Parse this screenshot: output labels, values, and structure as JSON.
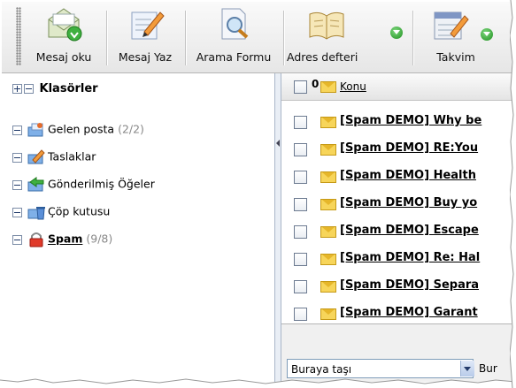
{
  "toolbar": {
    "buttons": [
      {
        "label": "Mesaj oku",
        "icon": "read-mail-icon"
      },
      {
        "label": "Mesaj Yaz",
        "icon": "compose-icon"
      },
      {
        "label": "Arama Formu",
        "icon": "search-form-icon"
      },
      {
        "label": "Adres defteri",
        "icon": "address-book-icon"
      },
      {
        "label": "Takvim",
        "icon": "calendar-icon"
      }
    ]
  },
  "folders": {
    "header": "Klasörler",
    "items": [
      {
        "label": "Gelen posta",
        "count": "(2/2)",
        "icon": "inbox-icon"
      },
      {
        "label": "Taslaklar",
        "count": "",
        "icon": "drafts-icon"
      },
      {
        "label": "Gönderilmiş Öğeler",
        "count": "",
        "icon": "sent-items-icon"
      },
      {
        "label": "Çöp kutusu",
        "count": "",
        "icon": "trash-icon"
      },
      {
        "label": "Spam",
        "count": "(9/8)",
        "icon": "spam-lock-icon"
      }
    ]
  },
  "messages": {
    "header_konu": "Konu",
    "header_flag": "0",
    "rows": [
      {
        "subject": "[Spam DEMO] Why be"
      },
      {
        "subject": "[Spam DEMO] RE:You"
      },
      {
        "subject": "[Spam DEMO] Health"
      },
      {
        "subject": "[Spam DEMO] Buy yo"
      },
      {
        "subject": "[Spam DEMO] Escape"
      },
      {
        "subject": "[Spam DEMO] Re: Hal"
      },
      {
        "subject": "[Spam DEMO] Separa"
      },
      {
        "subject": "[Spam DEMO] Garant"
      }
    ]
  },
  "move": {
    "select_value": "Buraya taşı",
    "second_label": "Bur"
  },
  "colors": {
    "accent_green": "#1e8f1e",
    "envelope": "#f7d55a",
    "panel_border": "#a9b6c8"
  }
}
